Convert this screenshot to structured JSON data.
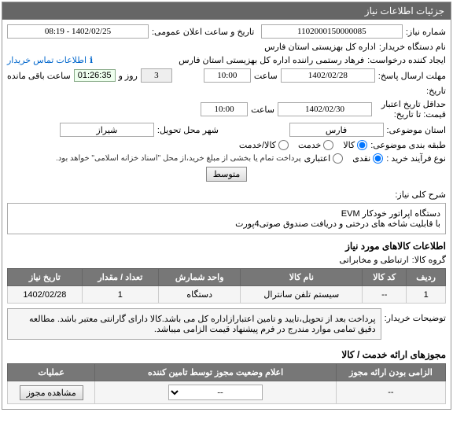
{
  "panel_title": "جزئیات اطلاعات نیاز",
  "labels": {
    "need_no": "شماره نیاز:",
    "public_date": "تاریخ و ساعت اعلان عمومی:",
    "buyer_org": "نام دستگاه خریدار:",
    "requester": "ایجاد کننده درخواست:",
    "contact_link": "اطلاعات تماس خریدار",
    "reply_deadline": "مهلت ارسال پاسخ:",
    "hour": "ساعت",
    "day_and": "روز و",
    "remaining": "ساعت باقی مانده",
    "history": "تاریخ:",
    "min_valid_until": "حداقل تاریخ اعتبار قیمت: تا تاریخ:",
    "subject_province": "استان موضوعی:",
    "delivery_city": "شهر محل تحویل:",
    "classification": "طبقه بندی موضوعی:",
    "goods": "کالا",
    "service": "خدمت",
    "goods_service": "کالا/خدمت",
    "buy_process": "نوع فرآیند خرید :",
    "buy_opt_cash": "نقدی",
    "buy_opt_credit": "اعتباری",
    "credit_note": "پرداخت تمام یا بخشی از مبلغ خرید،از محل \"اسناد خزانه اسلامی\" خواهد بود.",
    "medium": "متوسط",
    "need_title": "شرح کلی نیاز:",
    "goods_info": "اطلاعات کالاهای مورد نیاز",
    "goods_group": "گروه کالا:",
    "buyer_notes": "توضیحات خریدار:",
    "permits_section": "مجوزهای ارائه خدمت / کالا",
    "col_required": "الزامی بودن ارائه مجوز",
    "col_status": "اعلام وضعیت مجوز توسط تامین کننده",
    "col_ops": "عملیات",
    "view_permit": "مشاهده مجوز"
  },
  "values": {
    "need_no": "1102000150000085",
    "public_date": "1402/02/25 - 08:19",
    "buyer_org": "اداره کل بهزیستی استان فارس",
    "requester": "فرهاد  رستمی راننده اداره کل بهزیستی استان فارس",
    "reply_date": "1402/02/28",
    "reply_time": "10:00",
    "days_left": "3",
    "countdown": "01:26:35",
    "valid_date": "1402/02/30",
    "valid_time": "10:00",
    "province": "فارس",
    "city": "شیراز",
    "need_desc": "دستگاه اپراتور خودکار EVM\nبا قابلیت شاخه های درختی و دریافت صندوق صوتی4پورت",
    "goods_group": "ارتباطی و مخابراتی",
    "buyer_notes": "پرداخت بعد از تحویل،تایید و تامین اعتبارازاداره کل می باشد.کالا دارای گارانتی معتبر باشد. مطالعه دقیق تمامی موارد مندرج در فرم پیشنهاد قیمت الزامی میباشد."
  },
  "table": {
    "headers": [
      "ردیف",
      "کد کالا",
      "نام کالا",
      "واحد شمارش",
      "تعداد / مقدار",
      "تاریخ نیاز"
    ],
    "rows": [
      {
        "idx": "1",
        "code": "--",
        "name": "سیستم تلفن سانترال",
        "unit": "دستگاه",
        "qty": "1",
        "date": "1402/02/28"
      }
    ]
  },
  "permits": {
    "rows": [
      {
        "required": "--",
        "status": "--"
      }
    ]
  }
}
